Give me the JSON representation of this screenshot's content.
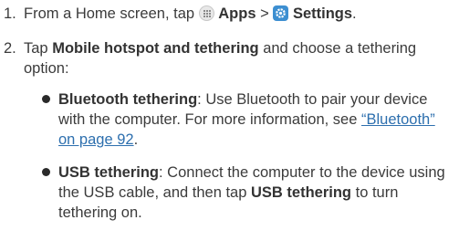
{
  "steps": [
    {
      "number": "1.",
      "prefix": "From a Home screen, tap",
      "apps_label": "Apps",
      "separator": ">",
      "settings_label": "Settings",
      "suffix": "."
    },
    {
      "number": "2.",
      "prefix": "Tap",
      "bold": "Mobile hotspot and tethering",
      "suffix": "and choose a tethering option:"
    }
  ],
  "bullets": [
    {
      "bold": "Bluetooth tethering",
      "text": ": Use Bluetooth to pair your device with the computer. For more information, see",
      "link": "“Bluetooth” on page 92",
      "suffix": "."
    },
    {
      "bold": "USB tethering",
      "text": ": Connect the computer to the device using the USB cable, and then tap",
      "bold2": "USB tethering",
      "suffix": "to turn tethering on."
    }
  ]
}
